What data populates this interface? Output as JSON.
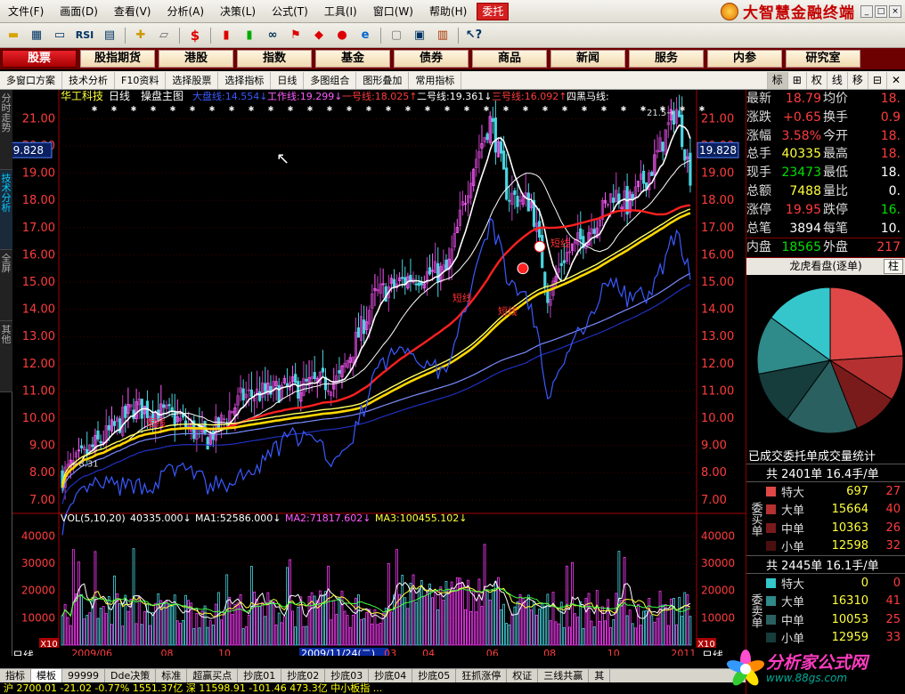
{
  "menu": {
    "items": [
      "文件(F)",
      "画面(D)",
      "查看(V)",
      "分析(A)",
      "决策(L)",
      "公式(T)",
      "工具(I)",
      "窗口(W)",
      "帮助(H)"
    ],
    "entrust": "委托",
    "brand": "大智慧金融终端"
  },
  "toolbar": {
    "icons": [
      "open-folder-icon",
      "kline-icon",
      "monitor-icon",
      "rsi-icon",
      "grid-icon",
      "crosshair-icon",
      "ruler-icon",
      "dollar-icon",
      "candles-icon",
      "gradient-icon",
      "binoculars-icon",
      "flag-icon",
      "diamond-icon",
      "lips-icon",
      "ie-icon",
      "memo-icon",
      "window-icon",
      "books-icon",
      "help-cursor-icon"
    ],
    "rsi_label": "RSI",
    "dollar_label": "$"
  },
  "nav": {
    "items": [
      "股票",
      "股指期货",
      "港股",
      "指数",
      "基金",
      "债券",
      "商品",
      "新闻",
      "服务",
      "内参",
      "研究室"
    ],
    "active": 0
  },
  "subbar": {
    "items": [
      "多窗口方案",
      "技术分析",
      "F10资料",
      "选择股票",
      "选择指标",
      "日线",
      "多图组合",
      "图形叠加",
      "常用指标"
    ]
  },
  "sidebtns": {
    "items": [
      "标",
      "⊞",
      "权",
      "线",
      "移",
      "⊟",
      "✕"
    ]
  },
  "lefttabs": {
    "items": [
      "分时走势",
      "技术分析",
      "全屏",
      "其他"
    ],
    "active": 1
  },
  "chart": {
    "stock_name": "华工科技",
    "period": "日线",
    "main_title": "操盘主图",
    "lines_legend": [
      {
        "name": "大盘线:",
        "value": "14.554",
        "arrow": "↓",
        "color": "#3a5aff"
      },
      {
        "name": "工作线:",
        "value": "19.299",
        "arrow": "↓",
        "color": "#ff5cff"
      },
      {
        "name": "一号线:",
        "value": "18.025",
        "arrow": "↑",
        "color": "#ff3c3c"
      },
      {
        "name": "二号线:",
        "value": "19.361",
        "arrow": "↓",
        "color": "#ffffff"
      },
      {
        "name": "三号线:",
        "value": "16.092",
        "arrow": "↑",
        "color": "#ff3c3c"
      },
      {
        "name": "四黑马线:",
        "value": "",
        "arrow": "",
        "color": "#ffffff"
      }
    ],
    "price_ticks": [
      "21.00",
      "20.00",
      "19.00",
      "18.00",
      "17.00",
      "16.00",
      "15.00",
      "14.00",
      "13.00",
      "12.00",
      "11.00",
      "10.00",
      "9.00",
      "8.00",
      "7.00"
    ],
    "current_price_tag": "19.828",
    "low_marker": "8.31",
    "high_marker": "21.5",
    "annotations": [
      "短线",
      "短线",
      "短线",
      "短线"
    ],
    "volume_title": "VOL(5,10,20)",
    "volume_legend": [
      {
        "name": "",
        "value": "40335.000",
        "arrow": "↓",
        "color": "#ffffff"
      },
      {
        "name": "MA1:",
        "value": "52586.000",
        "arrow": "↓",
        "color": "#ffffff"
      },
      {
        "name": "MA2:",
        "value": "71817.602",
        "arrow": "↓",
        "color": "#ff5cff"
      },
      {
        "name": "MA3:",
        "value": "100455.102",
        "arrow": "↓",
        "color": "#ffff3c"
      }
    ],
    "volume_ticks": [
      "40000",
      "30000",
      "20000",
      "10000"
    ],
    "x10_label": "X10",
    "period_left": "日线",
    "period_right": "日线",
    "date_labels": [
      "2009/06",
      "08",
      "10",
      "2009/11/24(二)",
      "03",
      "04",
      "06",
      "08",
      "10",
      "2011"
    ],
    "date_highlight": "2009/11/24(二)"
  },
  "tabs": {
    "items": [
      "指标",
      "模板",
      "99999",
      "Dde决策",
      "标准",
      "超赢买点",
      "抄底01",
      "抄底02",
      "抄底03",
      "抄底04",
      "抄底05",
      "狂抓涨停",
      "权证",
      "三线共赢",
      "其"
    ],
    "active": 1
  },
  "status": {
    "text": "沪  2700.01  -21.02  -0.77%  1551.37亿  深  11598.91  -101.46  473.3亿  中小板指  ..."
  },
  "quote": {
    "rows": [
      {
        "l1": "最新",
        "v1": "18.79",
        "c1": "r",
        "l2": "均价",
        "v2": "18.",
        "c2": "r"
      },
      {
        "l1": "涨跌",
        "v1": "+0.65",
        "c1": "r",
        "l2": "换手",
        "v2": "0.9",
        "c2": "r"
      },
      {
        "l1": "涨幅",
        "v1": "3.58%",
        "c1": "r",
        "l2": "今开",
        "v2": "18.",
        "c2": "r"
      },
      {
        "l1": "总手",
        "v1": "40335",
        "c1": "y",
        "l2": "最高",
        "v2": "18.",
        "c2": "r"
      },
      {
        "l1": "现手",
        "v1": "23473",
        "c1": "g",
        "l2": "最低",
        "v2": "18.",
        "c2": "w"
      },
      {
        "l1": "总额",
        "v1": "7488",
        "c1": "y",
        "l2": "量比",
        "v2": "0.",
        "c2": "w"
      },
      {
        "l1": "涨停",
        "v1": "19.95",
        "c1": "r",
        "l2": "跌停",
        "v2": "16.",
        "c2": "g"
      },
      {
        "l1": "总笔",
        "v1": "3894",
        "c1": "w",
        "l2": "每笔",
        "v2": "10.",
        "c2": "w"
      },
      {
        "l1": "内盘",
        "v1": "18565",
        "c1": "g",
        "l2": "外盘",
        "v2": "217",
        "c2": "r"
      }
    ],
    "longhu_title": "龙虎看盘(逐单)",
    "longhu_btn": "柱",
    "pie": {
      "values": [
        24,
        10,
        10,
        16,
        12,
        13,
        15
      ],
      "colors": [
        "#e04848",
        "#b53030",
        "#7a1b1b",
        "#2a6060",
        "#163c3c",
        "#2f8a8a",
        "#35c6cc"
      ]
    },
    "stats_title": "已成交委托单成交量统计",
    "buy": {
      "summary": "共 2401单 16.4手/单",
      "label": "委买单",
      "rows": [
        {
          "name": "特大",
          "v1": "697",
          "v2": "27",
          "color": "#e04848"
        },
        {
          "name": "大单",
          "v1": "15664",
          "v2": "40",
          "color": "#b53030"
        },
        {
          "name": "中单",
          "v1": "10363",
          "c": "",
          "v2": "26",
          "color": "#7a1b1b"
        },
        {
          "name": "小单",
          "v1": "12598",
          "v2": "32",
          "color": "#4a1010"
        }
      ]
    },
    "sell": {
      "summary": "共 2445单 16.1手/单",
      "label": "委卖单",
      "rows": [
        {
          "name": "特大",
          "v1": "0",
          "v2": "0",
          "color": "#35c6cc"
        },
        {
          "name": "大单",
          "v1": "16310",
          "v2": "41",
          "color": "#2f8a8a"
        },
        {
          "name": "中单",
          "v1": "10053",
          "v2": "25",
          "color": "#2a6060"
        },
        {
          "name": "小单",
          "v1": "12959",
          "v2": "33",
          "color": "#163c3c"
        }
      ]
    }
  },
  "watermark": {
    "text": "分析家公式网",
    "url": "www.88gs.com"
  }
}
